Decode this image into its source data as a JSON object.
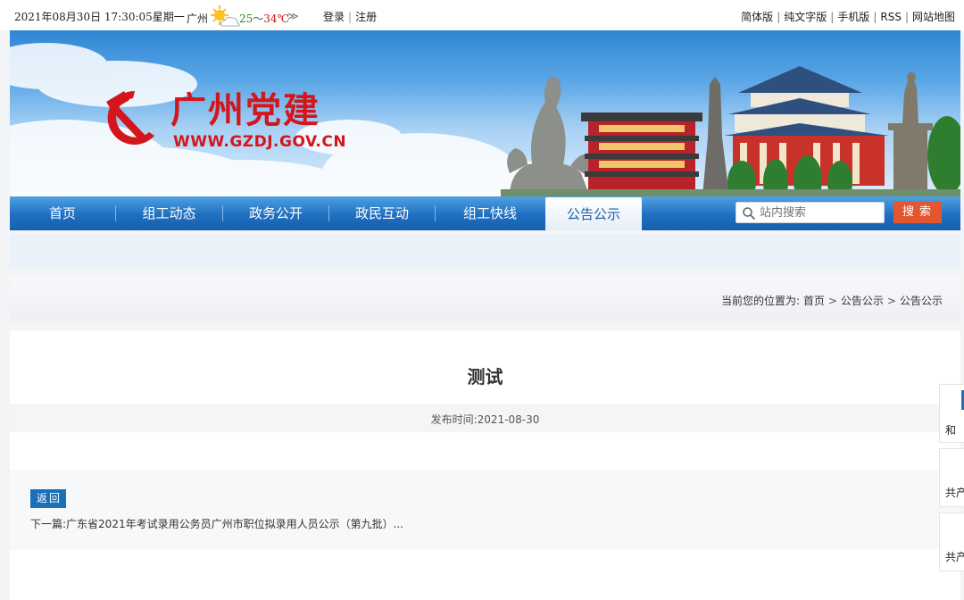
{
  "topbar": {
    "datetime": "2021年08月30日 17:30:05星期一",
    "city": "广州",
    "weather_icon": "sun-cloud-icon",
    "temp_low": "25",
    "temp_sep": "～",
    "temp_high": "34℃",
    "more_glyph": "≫",
    "login": "登录",
    "divider": "|",
    "register": "注册",
    "links": [
      "简体版",
      "纯文字版",
      "手机版",
      "RSS",
      "网站地图"
    ]
  },
  "banner": {
    "logo_text": "广州党建",
    "logo_url": "WWW.GZDJ.GOV.CN",
    "emblem_icon": "hammer-sickle-icon"
  },
  "nav": {
    "items": [
      "首页",
      "组工动态",
      "政务公开",
      "政民互动",
      "组工快线",
      "公告公示"
    ],
    "active_index": 5,
    "search_placeholder": "站内搜索",
    "search_button": "搜索"
  },
  "breadcrumb": {
    "prefix": "当前您的位置为:",
    "path": [
      "首页",
      "公告公示",
      "公告公示"
    ],
    "sep": ">"
  },
  "article": {
    "title": "测试",
    "publish_label": "发布时间:",
    "publish_date": "2021-08-30",
    "back_button": "返回",
    "next_label": "下一篇:",
    "next_title": "广东省2021年考试录用公务员广州市职位拟录用人员公示（第九批）..."
  },
  "side_panel": {
    "item1": "和",
    "item2": "共产",
    "item3": "共产"
  },
  "colors": {
    "party_red": "#d4161c",
    "nav_blue": "#1f6fc0",
    "search_orange": "#e4572e",
    "back_blue": "#1b6fb8"
  }
}
